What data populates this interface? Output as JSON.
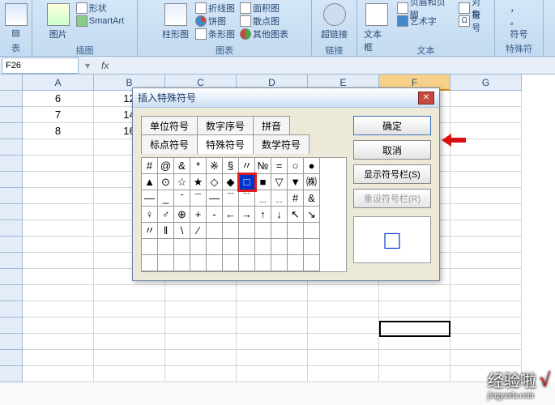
{
  "ribbon": {
    "group1": {
      "label": "表",
      "btn_table": "▤"
    },
    "group2": {
      "label": "插图",
      "btn_shapes": "形状",
      "btn_picture": "图片",
      "btn_smartart": "SmartArt"
    },
    "group3": {
      "label": "图表",
      "btn_column": "柱形图",
      "btn_line": "折线图",
      "btn_pie": "饼图",
      "btn_bar": "条形图",
      "btn_area": "面积图",
      "btn_scatter": "散点图",
      "btn_other": "其他图表"
    },
    "group4": {
      "label": "链接",
      "btn_hyperlink": "超链接"
    },
    "group5": {
      "label": "文本",
      "btn_textbox": "文本框",
      "btn_headerfooter": "页眉和页脚",
      "btn_wordart": "艺术字",
      "btn_object": "对象",
      "btn_symbol": "符号"
    },
    "group6": {
      "label": "特殊符",
      "btn_comma": "，",
      "btn_period": "。",
      "btn_symbols": "符号"
    }
  },
  "namebox": {
    "cell_ref": "F26",
    "fx": "fx"
  },
  "columns": [
    "A",
    "B",
    "C",
    "D",
    "E",
    "F",
    "G"
  ],
  "active_col_index": 5,
  "rows": [
    {
      "n": "",
      "cells": [
        "6",
        "12",
        "",
        "",
        "",
        "",
        ""
      ]
    },
    {
      "n": "",
      "cells": [
        "7",
        "14",
        "",
        "",
        "",
        "",
        ""
      ]
    },
    {
      "n": "",
      "cells": [
        "8",
        "16",
        "",
        "",
        "",
        "",
        ""
      ]
    }
  ],
  "dialog": {
    "title": "插入特殊符号",
    "tabs": {
      "r1": [
        "单位符号",
        "数字序号",
        "拼音"
      ],
      "r2": [
        "标点符号",
        "特殊符号",
        "数学符号"
      ]
    },
    "active_tab": "特殊符号",
    "buttons": {
      "ok": "确定",
      "cancel": "取消",
      "show_bar": "显示符号栏(S)",
      "reset_bar": "重设符号栏(R)"
    },
    "symbols": [
      [
        "#",
        "@",
        "&",
        "*",
        "※",
        "§",
        "〃",
        "№",
        "=",
        "○",
        "●"
      ],
      [
        "▲",
        "⊙",
        "☆",
        "★",
        "◇",
        "◆",
        "□",
        "■",
        "▽",
        "▼",
        "㈱"
      ],
      [
        "—",
        "_",
        "ˉ",
        "¯",
        "―",
        "﹉",
        "﹊",
        "﹍",
        "﹎",
        "#",
        "&"
      ],
      [
        "♀",
        "♂",
        "⊕",
        "+",
        "-",
        "←",
        "→",
        "↑",
        "↓",
        "↖",
        "↘"
      ],
      [
        "〃",
        "‖",
        "\\",
        "∕",
        "",
        "",
        "",
        "",
        "",
        "",
        ""
      ],
      [
        "",
        "",
        "",
        "",
        "",
        "",
        "",
        "",
        "",
        "",
        ""
      ],
      [
        "",
        "",
        "",
        "",
        "",
        "",
        "",
        "",
        "",
        "",
        ""
      ]
    ],
    "selected": {
      "row": 1,
      "col": 6
    },
    "preview": "□"
  },
  "watermark": {
    "text": "经验啦",
    "sub": "jingyanla.com",
    "check": "√"
  }
}
